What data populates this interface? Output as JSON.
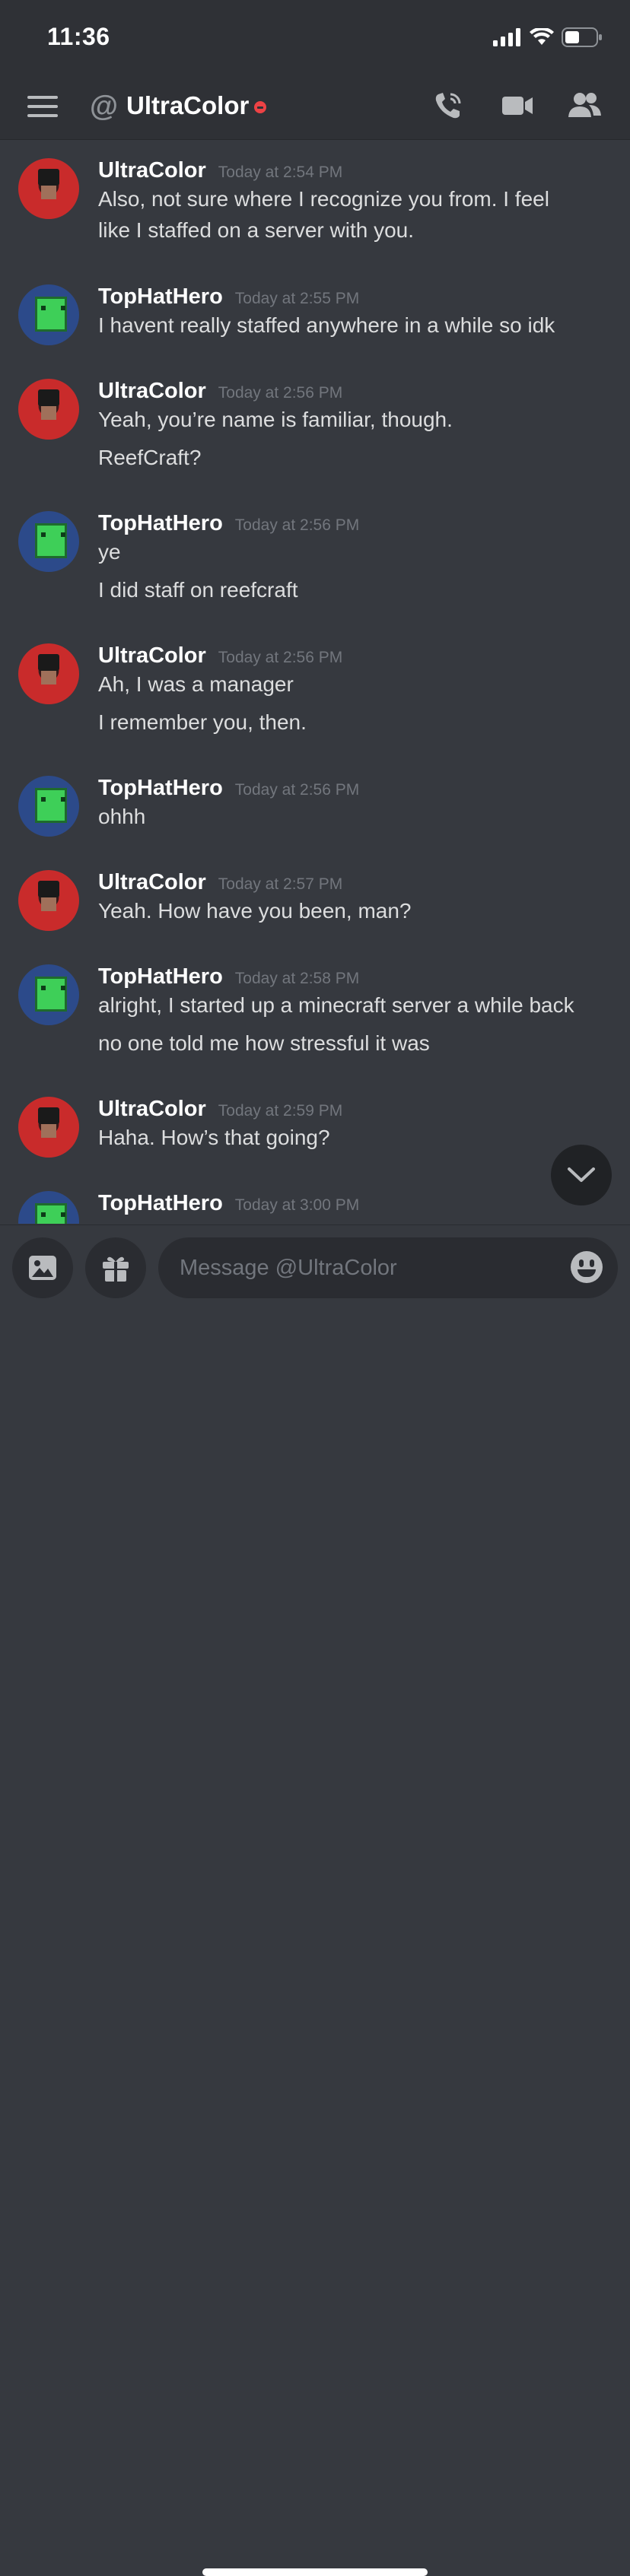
{
  "status": {
    "time": "11:36"
  },
  "header": {
    "title": "UltraColor",
    "at_symbol": "@"
  },
  "messages": [
    {
      "author": "UltraColor",
      "time": "Today at 2:54 PM",
      "avatar": "red-skin",
      "lines": [
        "Also, not sure where I recognize you from. I feel",
        "like I staffed on a server with you."
      ]
    },
    {
      "author": "TopHatHero",
      "time": "Today at 2:55 PM",
      "avatar": "green-skin",
      "lines": [
        "I havent really staffed anywhere in a while so idk"
      ]
    },
    {
      "author": "UltraColor",
      "time": "Today at 2:56 PM",
      "avatar": "red-skin",
      "lines": [
        "Yeah, you’re name is familiar, though.",
        "ReefCraft?"
      ]
    },
    {
      "author": "TopHatHero",
      "time": "Today at 2:56 PM",
      "avatar": "green-skin",
      "lines": [
        "ye",
        "I did staff on reefcraft"
      ]
    },
    {
      "author": "UltraColor",
      "time": "Today at 2:56 PM",
      "avatar": "red-skin",
      "lines": [
        "Ah, I was a manager",
        "I remember you, then."
      ]
    },
    {
      "author": "TopHatHero",
      "time": "Today at 2:56 PM",
      "avatar": "green-skin",
      "lines": [
        "ohhh"
      ]
    },
    {
      "author": "UltraColor",
      "time": "Today at 2:57 PM",
      "avatar": "red-skin",
      "lines": [
        "Yeah. How have you been, man?"
      ]
    },
    {
      "author": "TopHatHero",
      "time": "Today at 2:58 PM",
      "avatar": "green-skin",
      "lines": [
        "alright, I started up a minecraft server a while back",
        "no one told me how stressful it was"
      ]
    },
    {
      "author": "UltraColor",
      "time": "Today at 2:59 PM",
      "avatar": "red-skin",
      "lines": [
        "Haha. How’s that going?"
      ]
    },
    {
      "author": "TopHatHero",
      "time": "Today at 3:00 PM",
      "avatar": "green-skin",
      "lines": []
    }
  ],
  "composer": {
    "placeholder": "Message @UltraColor"
  },
  "colors": {
    "background": "#36393f",
    "header": "#2f3136",
    "dnd": "#ed4245"
  }
}
